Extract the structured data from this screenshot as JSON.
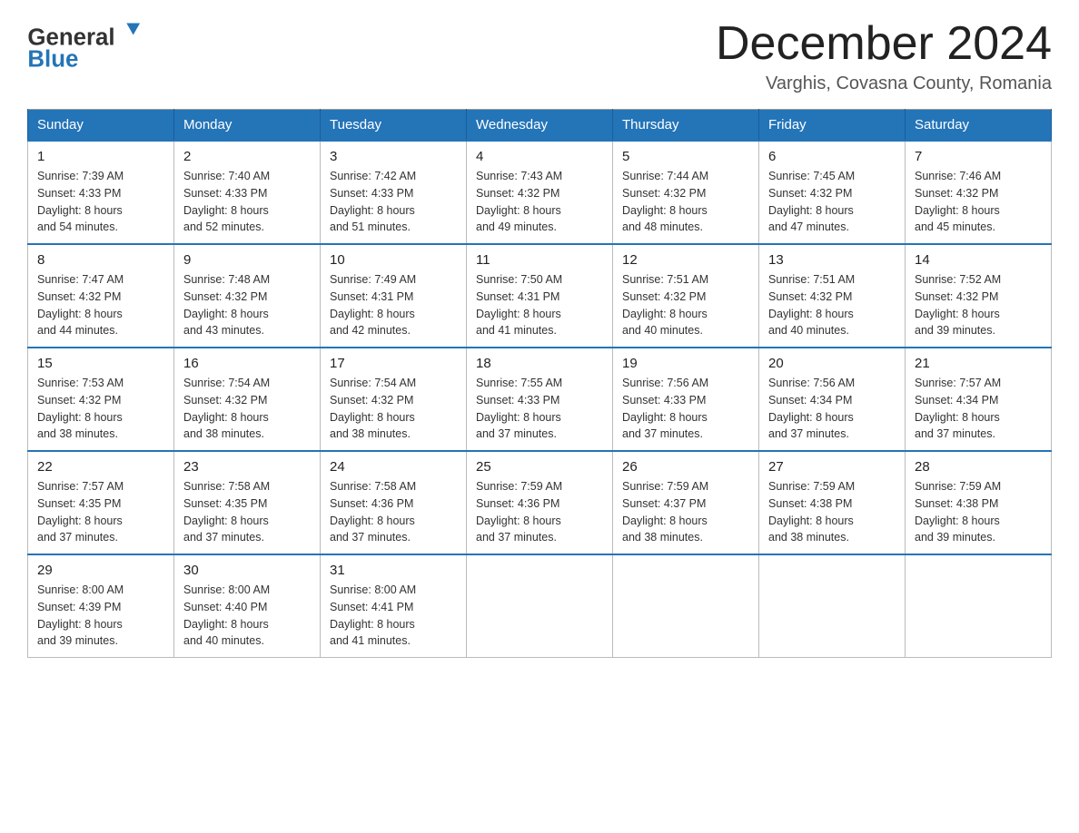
{
  "header": {
    "logo_general": "General",
    "logo_blue": "Blue",
    "month_title": "December 2024",
    "location": "Varghis, Covasna County, Romania"
  },
  "days_of_week": [
    "Sunday",
    "Monday",
    "Tuesday",
    "Wednesday",
    "Thursday",
    "Friday",
    "Saturday"
  ],
  "weeks": [
    [
      {
        "day": "1",
        "sunrise": "7:39 AM",
        "sunset": "4:33 PM",
        "daylight": "8 hours and 54 minutes."
      },
      {
        "day": "2",
        "sunrise": "7:40 AM",
        "sunset": "4:33 PM",
        "daylight": "8 hours and 52 minutes."
      },
      {
        "day": "3",
        "sunrise": "7:42 AM",
        "sunset": "4:33 PM",
        "daylight": "8 hours and 51 minutes."
      },
      {
        "day": "4",
        "sunrise": "7:43 AM",
        "sunset": "4:32 PM",
        "daylight": "8 hours and 49 minutes."
      },
      {
        "day": "5",
        "sunrise": "7:44 AM",
        "sunset": "4:32 PM",
        "daylight": "8 hours and 48 minutes."
      },
      {
        "day": "6",
        "sunrise": "7:45 AM",
        "sunset": "4:32 PM",
        "daylight": "8 hours and 47 minutes."
      },
      {
        "day": "7",
        "sunrise": "7:46 AM",
        "sunset": "4:32 PM",
        "daylight": "8 hours and 45 minutes."
      }
    ],
    [
      {
        "day": "8",
        "sunrise": "7:47 AM",
        "sunset": "4:32 PM",
        "daylight": "8 hours and 44 minutes."
      },
      {
        "day": "9",
        "sunrise": "7:48 AM",
        "sunset": "4:32 PM",
        "daylight": "8 hours and 43 minutes."
      },
      {
        "day": "10",
        "sunrise": "7:49 AM",
        "sunset": "4:31 PM",
        "daylight": "8 hours and 42 minutes."
      },
      {
        "day": "11",
        "sunrise": "7:50 AM",
        "sunset": "4:31 PM",
        "daylight": "8 hours and 41 minutes."
      },
      {
        "day": "12",
        "sunrise": "7:51 AM",
        "sunset": "4:32 PM",
        "daylight": "8 hours and 40 minutes."
      },
      {
        "day": "13",
        "sunrise": "7:51 AM",
        "sunset": "4:32 PM",
        "daylight": "8 hours and 40 minutes."
      },
      {
        "day": "14",
        "sunrise": "7:52 AM",
        "sunset": "4:32 PM",
        "daylight": "8 hours and 39 minutes."
      }
    ],
    [
      {
        "day": "15",
        "sunrise": "7:53 AM",
        "sunset": "4:32 PM",
        "daylight": "8 hours and 38 minutes."
      },
      {
        "day": "16",
        "sunrise": "7:54 AM",
        "sunset": "4:32 PM",
        "daylight": "8 hours and 38 minutes."
      },
      {
        "day": "17",
        "sunrise": "7:54 AM",
        "sunset": "4:32 PM",
        "daylight": "8 hours and 38 minutes."
      },
      {
        "day": "18",
        "sunrise": "7:55 AM",
        "sunset": "4:33 PM",
        "daylight": "8 hours and 37 minutes."
      },
      {
        "day": "19",
        "sunrise": "7:56 AM",
        "sunset": "4:33 PM",
        "daylight": "8 hours and 37 minutes."
      },
      {
        "day": "20",
        "sunrise": "7:56 AM",
        "sunset": "4:34 PM",
        "daylight": "8 hours and 37 minutes."
      },
      {
        "day": "21",
        "sunrise": "7:57 AM",
        "sunset": "4:34 PM",
        "daylight": "8 hours and 37 minutes."
      }
    ],
    [
      {
        "day": "22",
        "sunrise": "7:57 AM",
        "sunset": "4:35 PM",
        "daylight": "8 hours and 37 minutes."
      },
      {
        "day": "23",
        "sunrise": "7:58 AM",
        "sunset": "4:35 PM",
        "daylight": "8 hours and 37 minutes."
      },
      {
        "day": "24",
        "sunrise": "7:58 AM",
        "sunset": "4:36 PM",
        "daylight": "8 hours and 37 minutes."
      },
      {
        "day": "25",
        "sunrise": "7:59 AM",
        "sunset": "4:36 PM",
        "daylight": "8 hours and 37 minutes."
      },
      {
        "day": "26",
        "sunrise": "7:59 AM",
        "sunset": "4:37 PM",
        "daylight": "8 hours and 38 minutes."
      },
      {
        "day": "27",
        "sunrise": "7:59 AM",
        "sunset": "4:38 PM",
        "daylight": "8 hours and 38 minutes."
      },
      {
        "day": "28",
        "sunrise": "7:59 AM",
        "sunset": "4:38 PM",
        "daylight": "8 hours and 39 minutes."
      }
    ],
    [
      {
        "day": "29",
        "sunrise": "8:00 AM",
        "sunset": "4:39 PM",
        "daylight": "8 hours and 39 minutes."
      },
      {
        "day": "30",
        "sunrise": "8:00 AM",
        "sunset": "4:40 PM",
        "daylight": "8 hours and 40 minutes."
      },
      {
        "day": "31",
        "sunrise": "8:00 AM",
        "sunset": "4:41 PM",
        "daylight": "8 hours and 41 minutes."
      },
      null,
      null,
      null,
      null
    ]
  ],
  "labels": {
    "sunrise": "Sunrise:",
    "sunset": "Sunset:",
    "daylight": "Daylight:"
  }
}
